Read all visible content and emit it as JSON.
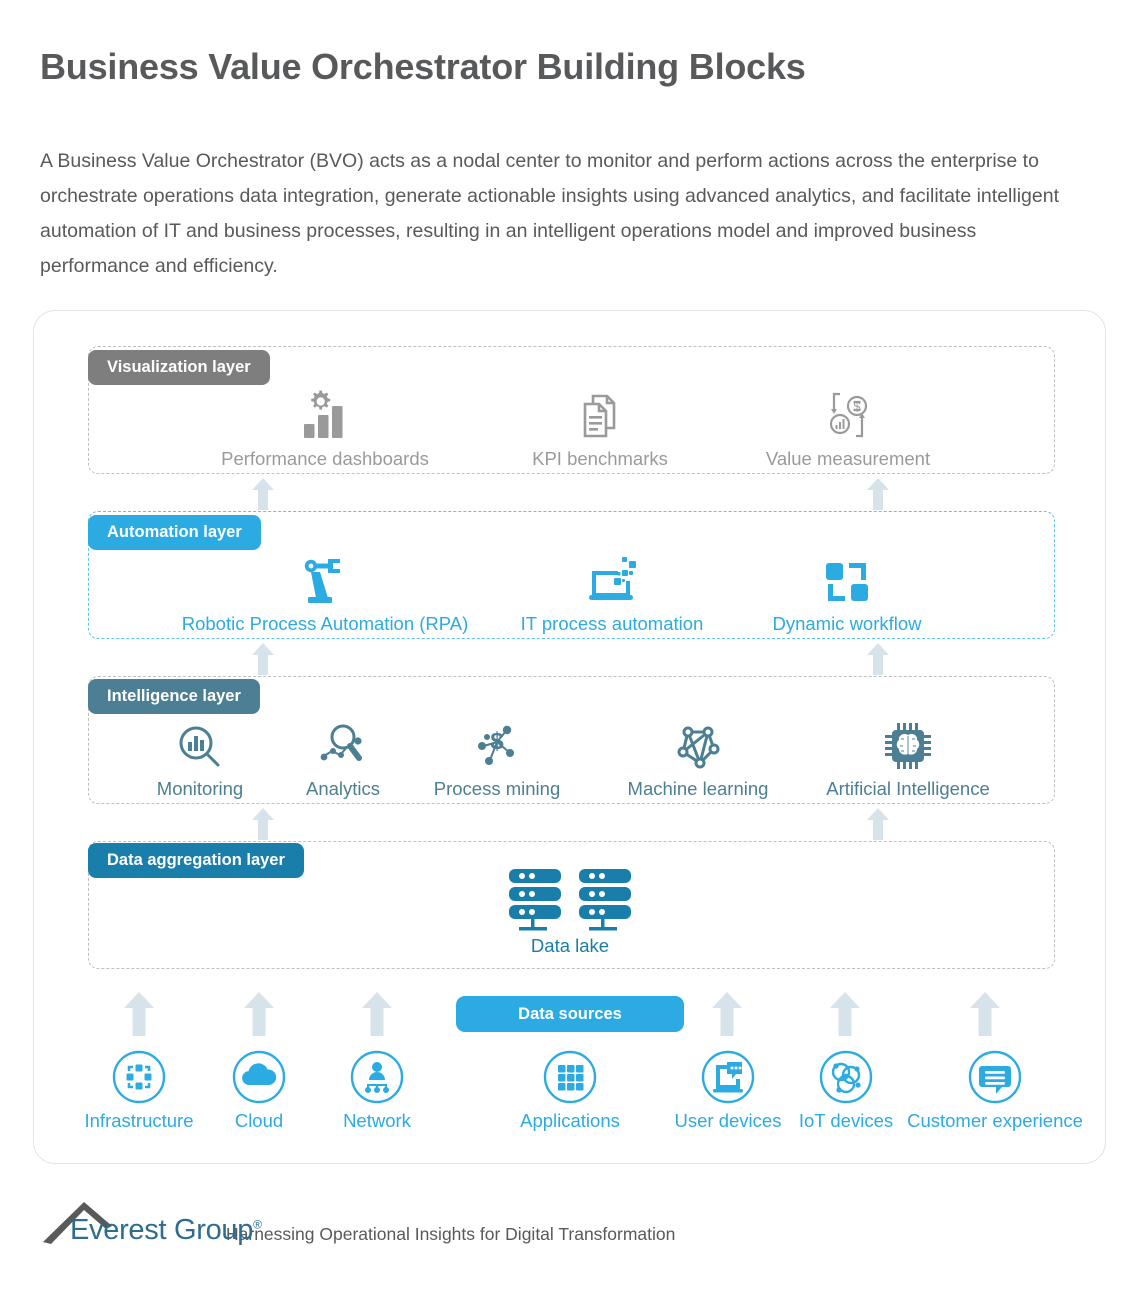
{
  "header": {
    "title": "Business Value Orchestrator Building Blocks",
    "intro": "A Business Value Orchestrator (BVO) acts as a nodal center to monitor and perform actions across the enterprise to orchestrate operations data integration, generate actionable insights using advanced analytics, and facilitate intelligent automation of IT and business processes, resulting in an intelligent operations model and improved business performance and efficiency."
  },
  "colors": {
    "visualization": "#7e7e7e",
    "automation": "#2cabe3",
    "intelligence": "#4c7f93",
    "data_aggregation": "#1a7eaa",
    "data_sources": "#2cabe3",
    "arrow": "#d7e3ea",
    "dashed_border_gray": "#bfbfbf",
    "dashed_border_blue": "#5ec2ef",
    "text_gray": "#58595b",
    "logo_blue": "#2e6d8e"
  },
  "layers": {
    "visualization": {
      "label": "Visualization layer",
      "items": [
        {
          "label": "Performance dashboards",
          "icon": "gear-bar-chart-icon"
        },
        {
          "label": "KPI benchmarks",
          "icon": "documents-icon"
        },
        {
          "label": "Value measurement",
          "icon": "value-cycle-icon"
        }
      ]
    },
    "automation": {
      "label": "Automation layer",
      "items": [
        {
          "label": "Robotic Process Automation (RPA)",
          "icon": "robot-arm-icon"
        },
        {
          "label": "IT process automation",
          "icon": "laptop-pixels-icon"
        },
        {
          "label": "Dynamic workflow",
          "icon": "workflow-squares-icon"
        }
      ]
    },
    "intelligence": {
      "label": "Intelligence layer",
      "items": [
        {
          "label": "Monitoring",
          "icon": "magnifier-bars-icon"
        },
        {
          "label": "Analytics",
          "icon": "magnifier-scatter-icon"
        },
        {
          "label": "Process mining",
          "icon": "dollar-network-icon"
        },
        {
          "label": "Machine learning",
          "icon": "neural-graph-icon"
        },
        {
          "label": "Artificial Intelligence",
          "icon": "brain-chip-icon"
        }
      ]
    },
    "data_aggregation": {
      "label": "Data aggregation layer",
      "items": [
        {
          "label": "Data lake",
          "icon": "server-stacks-icon"
        }
      ]
    },
    "data_sources": {
      "label": "Data sources",
      "items": [
        {
          "label": "Infrastructure",
          "icon": "infrastructure-frame-icon"
        },
        {
          "label": "Cloud",
          "icon": "cloud-icon"
        },
        {
          "label": "Network",
          "icon": "network-hierarchy-icon"
        },
        {
          "label": "Applications",
          "icon": "app-grid-icon"
        },
        {
          "label": "User devices",
          "icon": "laptop-chat-icon"
        },
        {
          "label": "IoT devices",
          "icon": "iot-globe-icon"
        },
        {
          "label": "Customer experience",
          "icon": "speech-bubble-icon"
        }
      ]
    }
  },
  "footer": {
    "logo_name": "Everest Group",
    "logo_registered": "®",
    "tagline": "Harnessing Operational Insights for Digital Transformation"
  }
}
